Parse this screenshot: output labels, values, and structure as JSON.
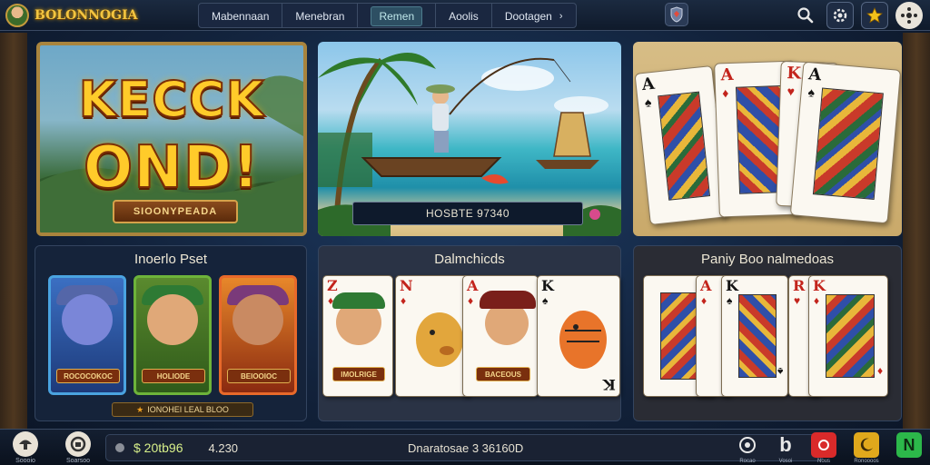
{
  "header": {
    "logo_text": "BOLONNOGIA",
    "tabs": [
      {
        "label": "Mabennaan"
      },
      {
        "label": "Menebran"
      },
      {
        "label": "Remen",
        "active": true
      },
      {
        "label": "Aoolis"
      },
      {
        "label": "Dootagen",
        "has_chevron": true
      }
    ],
    "shield_icon": "shield-icon",
    "right_icons": [
      "search-icon",
      "gear-icon",
      "star-icon",
      "settings-wheel-icon"
    ]
  },
  "hero": {
    "title_line1": "KECCK",
    "title_line2": "OND!",
    "plaque": "SIOONYPEADA"
  },
  "fishing": {
    "score_label": "HOSBTE 97340"
  },
  "sections": {
    "left": {
      "title": "Inoerlo Pset",
      "cards": [
        {
          "plaque": "ROCOCOKOC",
          "color": "#4aa3e0"
        },
        {
          "plaque": "HOLIODE",
          "color": "#6db33a"
        },
        {
          "plaque": "BEIOOIOC",
          "color": "#e8692a"
        }
      ],
      "note": "IONOHEI LEAL BLOO"
    },
    "middle": {
      "title": "Dalmchicds",
      "cards": [
        {
          "rank": "Z",
          "suit": "♦",
          "plaque": "IMOLRIGE"
        },
        {
          "rank": "N",
          "suit": "♦"
        },
        {
          "rank": "A",
          "suit": "♦",
          "plaque": "BACEOUS"
        },
        {
          "rank": "K",
          "suit": "♠"
        }
      ]
    },
    "right": {
      "title": "Paniy Boo nalmedoas",
      "cards": [
        {
          "rank": "A",
          "suit": "♦"
        },
        {
          "rank": "K",
          "suit": "♠"
        },
        {
          "rank": "R",
          "suit": "♥"
        },
        {
          "rank": "K",
          "suit": "♦"
        }
      ]
    }
  },
  "top_cards": [
    {
      "rank": "A",
      "suit": "♠"
    },
    {
      "rank": "A",
      "suit": "♦"
    },
    {
      "rank": "K",
      "suit": "♥"
    },
    {
      "rank": "A",
      "suit": "♠"
    }
  ],
  "footer": {
    "left_buttons": [
      {
        "label": "Soooio",
        "icon": "mushroom-icon"
      },
      {
        "label": "Soarsoo",
        "icon": "coin-icon"
      }
    ],
    "coins": "$ 20tb96",
    "value": "4.230",
    "status_text": "Dnaratosae 3 36160D",
    "right_icons": [
      {
        "label": "Rocao",
        "icon": "target-icon"
      },
      {
        "label": "Vosoi",
        "icon": "b-icon"
      },
      {
        "label": "Nous",
        "icon": "gift-icon"
      },
      {
        "label": "Ronoooos",
        "icon": "moon-icon"
      },
      {
        "label": "",
        "icon": "n-icon"
      }
    ]
  }
}
